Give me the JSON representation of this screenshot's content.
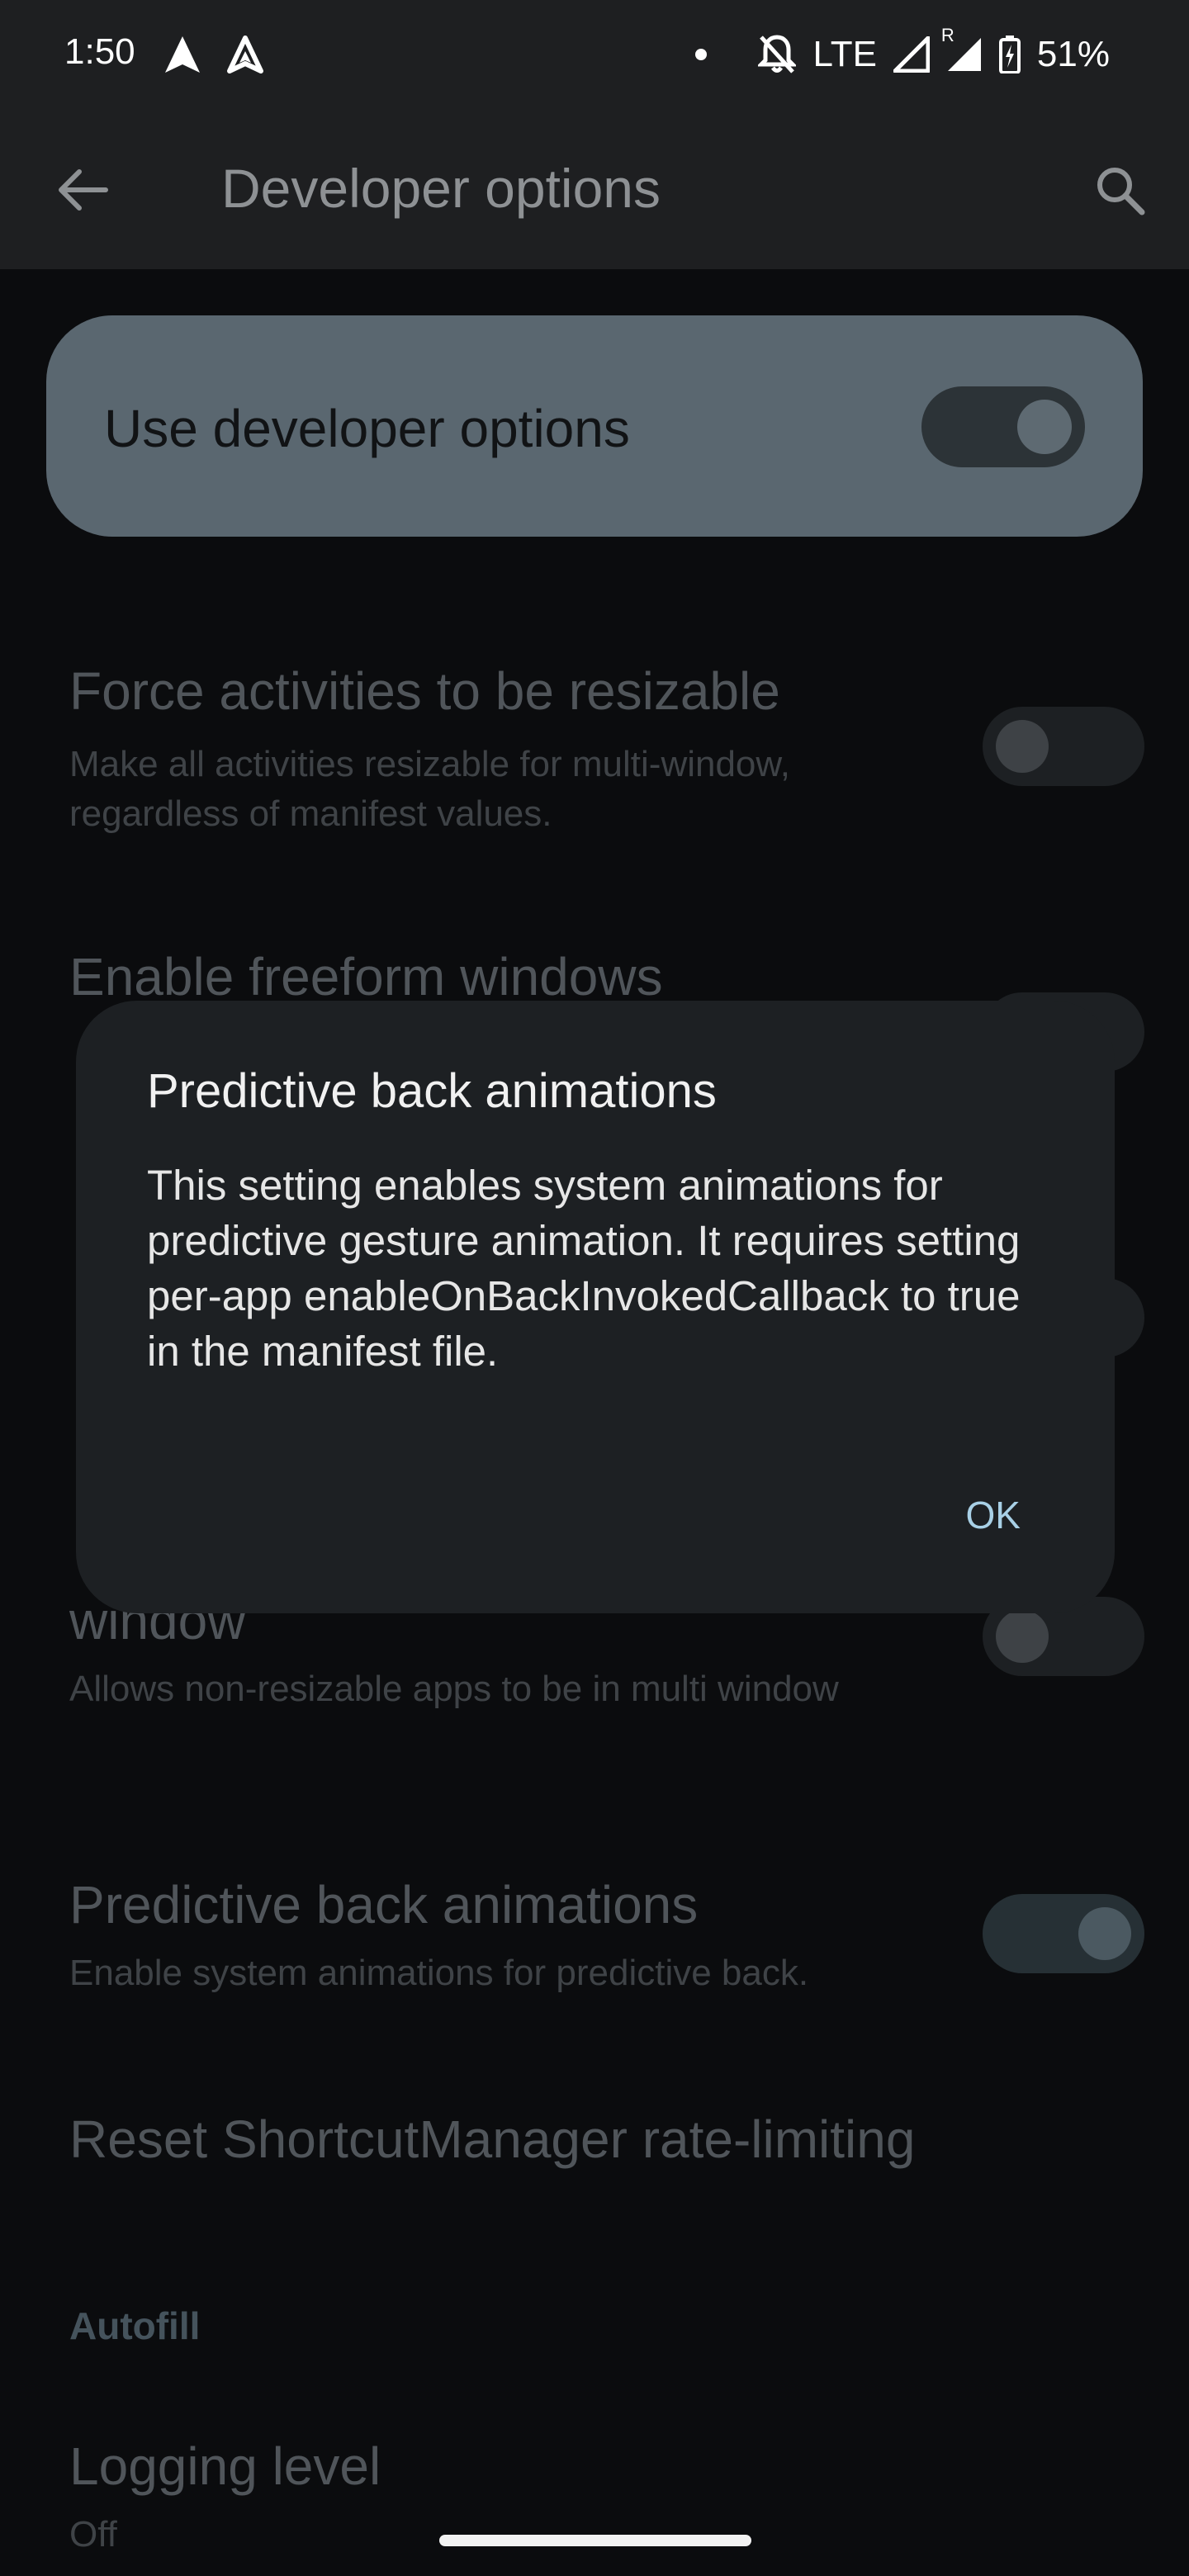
{
  "status_bar": {
    "time": "1:50",
    "network": "LTE",
    "roaming": "R",
    "battery": "51%"
  },
  "app_bar": {
    "title": "Developer options"
  },
  "main_toggle": {
    "label": "Use developer options",
    "checked": true
  },
  "settings": [
    {
      "title": "Force activities to be resizable",
      "summary": "Make all activities resizable for multi-window, regardless of manifest values.",
      "checked": false
    },
    {
      "title": "Enable freeform windows",
      "summary": "",
      "checked": false
    },
    {
      "title": "",
      "summary": "",
      "checked": false
    },
    {
      "title_fragment": "window",
      "summary": "Allows non-resizable apps to be in multi window",
      "checked": false
    },
    {
      "title": "Predictive back animations",
      "summary": "Enable system animations for predictive back.",
      "checked": true
    },
    {
      "title": "Reset ShortcutManager rate-limiting"
    }
  ],
  "sections": {
    "autofill": "Autofill"
  },
  "logging_level": {
    "title": "Logging level",
    "value": "Off"
  },
  "dialog": {
    "title": "Predictive back animations",
    "message": "This setting enables system animations for predictive gesture animation. It requires setting per-app enableOnBackInvokedCallback to true in the manifest file.",
    "ok_label": "OK"
  },
  "colors": {
    "accent": "#a8d0e6",
    "card": "#5a6770",
    "dialog": "#1d2023"
  }
}
